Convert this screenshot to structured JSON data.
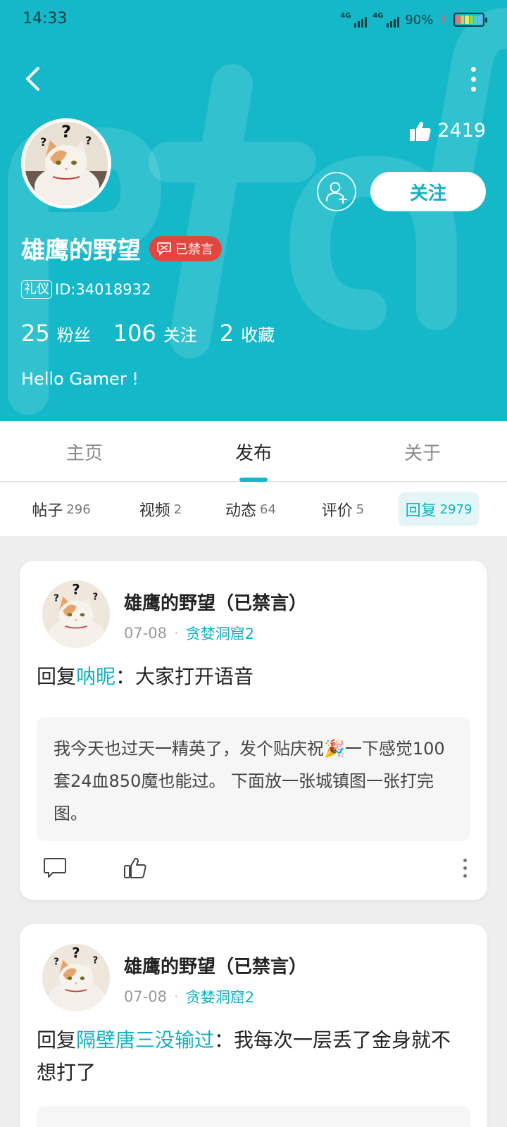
{
  "status_bar": {
    "time": "14:33",
    "network_1": "4G",
    "network_2": "4G",
    "battery": "90%"
  },
  "header": {
    "likes_count": "2419",
    "follow_label": "关注",
    "user_name": "雄鹰的野望",
    "banned_label": "已禁言",
    "etiquette_tag": "礼仪",
    "user_id": "ID:34018932",
    "stats": [
      {
        "num": "25",
        "label": "粉丝"
      },
      {
        "num": "106",
        "label": "关注"
      },
      {
        "num": "2",
        "label": "收藏"
      }
    ],
    "bio": "Hello Gamer !"
  },
  "main_tabs": [
    {
      "label": "主页",
      "active": false
    },
    {
      "label": "发布",
      "active": true
    },
    {
      "label": "关于",
      "active": false
    }
  ],
  "sub_tabs": [
    {
      "label": "帖子",
      "count": "296",
      "active": false
    },
    {
      "label": "视频",
      "count": "2",
      "active": false
    },
    {
      "label": "动态",
      "count": "64",
      "active": false
    },
    {
      "label": "评价",
      "count": "5",
      "active": false
    },
    {
      "label": "回复",
      "count": "2979",
      "active": true
    }
  ],
  "feed": [
    {
      "author": "雄鹰的野望（已禁言）",
      "date": "07-08",
      "group": "贪婪洞窟2",
      "reply_prefix": "回复",
      "reply_to": "呐昵",
      "reply_sep": "：",
      "reply_text": "大家打开语音",
      "quote_text": "我今天也过天一精英了，发个贴庆祝🎉一下感觉100套24血850魔也能过。 下面放一张城镇图一张打完图。"
    },
    {
      "author": "雄鹰的野望（已禁言）",
      "date": "07-08",
      "group": "贪婪洞窟2",
      "reply_prefix": "回复",
      "reply_to": "隔壁唐三没输过",
      "reply_sep": "：",
      "reply_text": "我每次一层丢了金身就不想打了"
    }
  ],
  "colors": {
    "header_bg": "#14b8c8",
    "accent": "#14b0c2",
    "banned_badge": "#e2473f"
  }
}
